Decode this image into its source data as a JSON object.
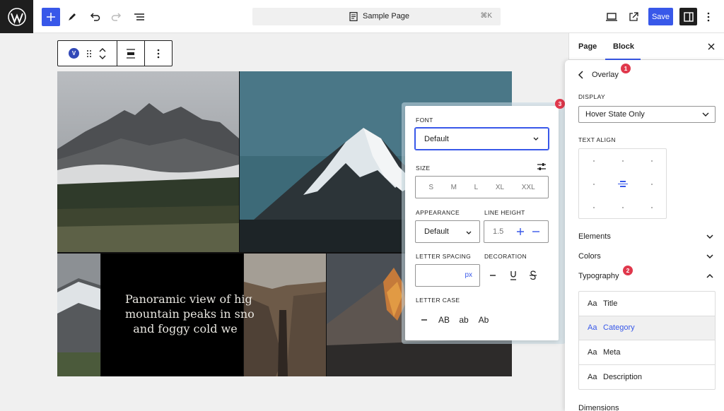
{
  "topbar": {
    "doc_title": "Sample Page",
    "shortcut": "⌘K",
    "save_label": "Save"
  },
  "block_toolbar": {
    "badge": "V"
  },
  "canvas": {
    "caption": [
      "Panoramic view of hig",
      "mountain peaks in sno",
      "and foggy cold we"
    ]
  },
  "popover": {
    "font_label": "FONT",
    "font_value": "Default",
    "size_label": "SIZE",
    "sizes": [
      "S",
      "M",
      "L",
      "XL",
      "XXL"
    ],
    "appearance_label": "APPEARANCE",
    "appearance_value": "Default",
    "line_height_label": "LINE HEIGHT",
    "line_height_value": "1.5",
    "letter_spacing_label": "LETTER SPACING",
    "letter_spacing_unit": "px",
    "decoration_label": "DECORATION",
    "letter_case_label": "LETTER CASE",
    "letter_cases": [
      "AB",
      "ab",
      "Ab"
    ]
  },
  "sidebar": {
    "tabs": [
      "Page",
      "Block"
    ],
    "panel_title": "Overlay",
    "display_label": "DISPLAY",
    "display_value": "Hover State Only",
    "text_align_label": "TEXT ALIGN",
    "sections": [
      "Elements",
      "Colors",
      "Typography",
      "Dimensions"
    ],
    "typography_items": [
      {
        "label": "Title"
      },
      {
        "label": "Category"
      },
      {
        "label": "Meta"
      },
      {
        "label": "Description"
      }
    ],
    "aa": "Aa"
  },
  "markers": [
    "1",
    "2",
    "3"
  ],
  "colors": {
    "accent": "#3858e9",
    "marker": "#e0384c"
  }
}
